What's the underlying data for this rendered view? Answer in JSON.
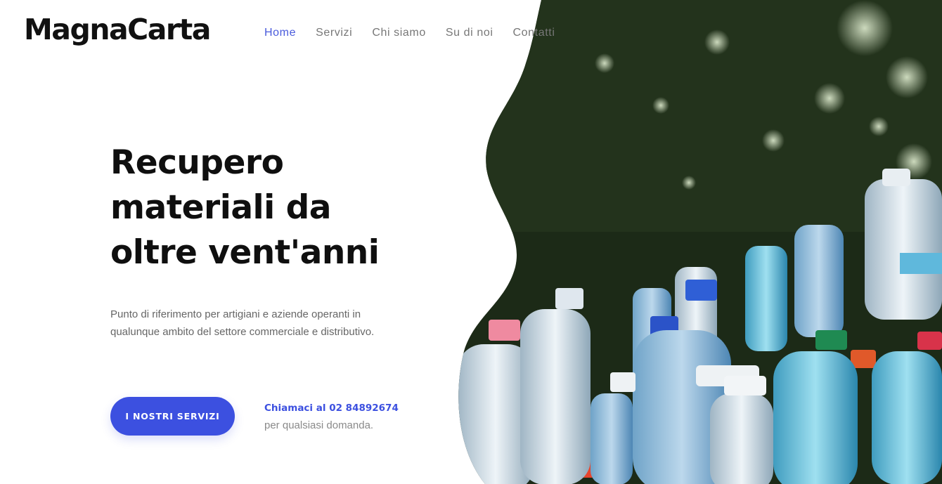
{
  "brand": {
    "logo_text": "MagnaCarta"
  },
  "nav": {
    "items": [
      {
        "label": "Home",
        "active": true
      },
      {
        "label": "Servizi",
        "active": false
      },
      {
        "label": "Chi siamo",
        "active": false
      },
      {
        "label": "Su di noi",
        "active": false
      },
      {
        "label": "Contatti",
        "active": false
      }
    ]
  },
  "hero": {
    "headline_lines": [
      "Recupero",
      "materiali da",
      "oltre vent'anni"
    ],
    "subtitle_lines": [
      "Punto di riferimento per artigiani e aziende operanti in",
      "qualunque ambito del settore commerciale e distributivo."
    ],
    "cta_label": "I NOSTRI SERVIZI",
    "call_label": "Chiamaci al 02 84892674",
    "call_sub": "per qualsiasi domanda.",
    "image_subject": "plastic-bottles-photo"
  },
  "colors": {
    "accent": "#3c50e0",
    "nav_active": "#4a5bdc",
    "nav_text": "#777777",
    "headline": "#0f0f0f",
    "body_text": "#666666"
  }
}
